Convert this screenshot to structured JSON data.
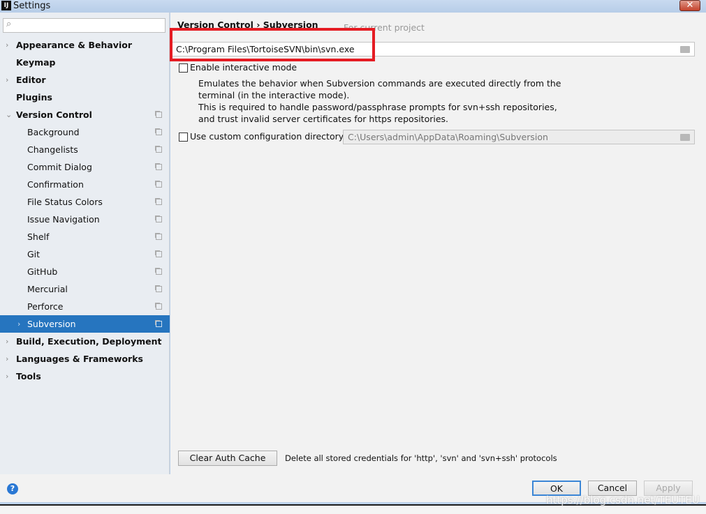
{
  "window": {
    "title": "Settings",
    "close_label": "✕"
  },
  "search": {
    "icon": "search-icon",
    "value": ""
  },
  "sidebar": {
    "items": [
      {
        "label": "Appearance & Behavior",
        "level": "top",
        "expandable": true
      },
      {
        "label": "Keymap",
        "level": "top"
      },
      {
        "label": "Editor",
        "level": "top",
        "expandable": true
      },
      {
        "label": "Plugins",
        "level": "top"
      },
      {
        "label": "Version Control",
        "level": "top",
        "expanded": true,
        "project": true
      },
      {
        "label": "Background",
        "level": "sub",
        "project": true
      },
      {
        "label": "Changelists",
        "level": "sub",
        "project": true
      },
      {
        "label": "Commit Dialog",
        "level": "sub",
        "project": true
      },
      {
        "label": "Confirmation",
        "level": "sub",
        "project": true
      },
      {
        "label": "File Status Colors",
        "level": "sub",
        "project": true
      },
      {
        "label": "Issue Navigation",
        "level": "sub",
        "project": true
      },
      {
        "label": "Shelf",
        "level": "sub",
        "project": true
      },
      {
        "label": "Git",
        "level": "sub",
        "project": true
      },
      {
        "label": "GitHub",
        "level": "sub",
        "project": true
      },
      {
        "label": "Mercurial",
        "level": "sub",
        "project": true
      },
      {
        "label": "Perforce",
        "level": "sub",
        "project": true
      },
      {
        "label": "Subversion",
        "level": "sub",
        "project": true,
        "selected": true,
        "expandable": true
      },
      {
        "label": "Build, Execution, Deployment",
        "level": "top",
        "expandable": true
      },
      {
        "label": "Languages & Frameworks",
        "level": "top",
        "expandable": true
      },
      {
        "label": "Tools",
        "level": "top",
        "expandable": true
      }
    ]
  },
  "main": {
    "breadcrumb": "Version Control  ›  Subversion",
    "for_current_project": "For current project",
    "svn_path": "C:\\Program Files\\TortoiseSVN\\bin\\svn.exe",
    "interactive_mode": {
      "label": "Enable interactive mode",
      "checked": false
    },
    "description": [
      "Emulates the behavior when Subversion commands are executed directly from the",
      "terminal (in the interactive mode).",
      "This is required to handle password/passphrase prompts for svn+ssh repositories,",
      "and trust invalid server certificates for https repositories."
    ],
    "custom_config": {
      "label": "Use custom configuration directory:",
      "checked": false,
      "value": "C:\\Users\\admin\\AppData\\Roaming\\Subversion"
    },
    "clear_auth_cache": "Clear Auth Cache",
    "clear_auth_desc": "Delete all stored credentials for 'http', 'svn' and 'svn+ssh' protocols"
  },
  "footer": {
    "help": "?",
    "ok": "OK",
    "cancel": "Cancel",
    "apply": "Apply"
  },
  "watermark": "https://blog.csdn.net/TEUTEU",
  "colors": {
    "selection": "#2675bf",
    "highlight_box": "#e51c23"
  }
}
